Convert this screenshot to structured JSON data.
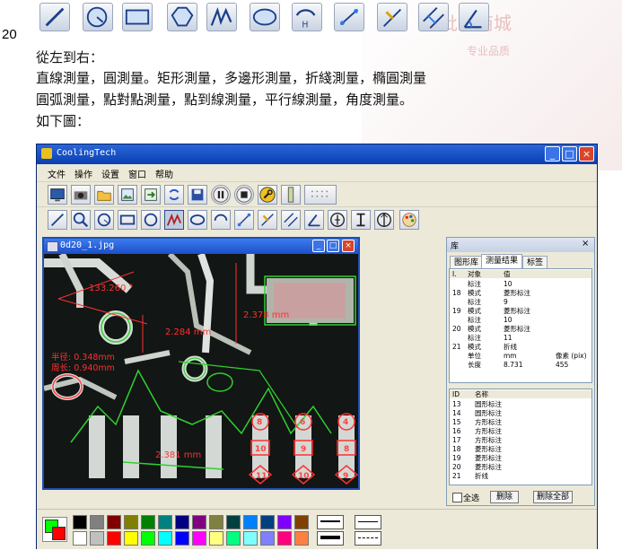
{
  "page_number": "20",
  "intro_line": "從左到右：",
  "line_1": "直線測量，圓測量。矩形測量，多邊形測量，折綫測量，橢圓測量",
  "line_2": "圓弧測量，點對點測量，點到線測量，平行線測量，角度測量。",
  "line_3": "如下圖：",
  "watermark": [
    "文批发商城",
    "专业品质"
  ],
  "top_tools": [
    "line-tool-icon",
    "circle-tool-icon",
    "rectangle-tool-icon",
    "polygon-tool-icon",
    "polyline-tool-icon",
    "ellipse-tool-icon",
    "arc-tool-icon",
    "point-to-point-icon",
    "point-to-line-icon",
    "parallel-lines-icon",
    "angle-tool-icon"
  ],
  "app": {
    "title": "CoolingTech",
    "menus": [
      "文件",
      "操作",
      "设置",
      "窗口",
      "帮助"
    ],
    "image_window_title": "0d20_1.jpg",
    "measurements": {
      "angle": "133.260 °",
      "distance1": "2.284 mm",
      "rect": "2.378 mm",
      "radius": "半径: 0.348mm",
      "perimeter": "周长: 0.940mm",
      "length": "2.381 mm"
    },
    "panel": {
      "title": "库",
      "tabs": [
        "图形库",
        "测量结果",
        "标签"
      ],
      "list1_header": [
        "I.",
        "对象",
        "值"
      ],
      "list1_rows": [
        [
          "",
          "标注",
          "10"
        ],
        [
          "18",
          "模式",
          "菱形标注"
        ],
        [
          "",
          "标注",
          "9"
        ],
        [
          "19",
          "模式",
          "菱形标注"
        ],
        [
          "",
          "标注",
          "10"
        ],
        [
          "20",
          "模式",
          "菱形标注"
        ],
        [
          "",
          "标注",
          "11"
        ],
        [
          "21",
          "模式",
          "折线"
        ],
        [
          "",
          "单位",
          "mm"
        ],
        [
          "",
          "长度",
          "8.731"
        ]
      ],
      "list1_extra": [
        "像素 (pix)",
        "455"
      ],
      "list2_header": [
        "ID",
        "名称"
      ],
      "list2_rows": [
        [
          "13",
          "圆形标注"
        ],
        [
          "14",
          "圆形标注"
        ],
        [
          "15",
          "方形标注"
        ],
        [
          "16",
          "方形标注"
        ],
        [
          "17",
          "方形标注"
        ],
        [
          "18",
          "菱形标注"
        ],
        [
          "19",
          "菱形标注"
        ],
        [
          "20",
          "菱形标注"
        ],
        [
          "21",
          "折线"
        ]
      ],
      "select_all": "全选",
      "delete_btn": "删除",
      "delete_all_btn": "删除全部"
    },
    "palette_colors_top": [
      "#000000",
      "#808080",
      "#800000",
      "#808000",
      "#008000",
      "#008080",
      "#000080",
      "#800080",
      "#808040",
      "#004040",
      "#0080ff",
      "#004080",
      "#8000ff",
      "#804000"
    ],
    "palette_colors_bottom": [
      "#ffffff",
      "#c0c0c0",
      "#ff0000",
      "#ffff00",
      "#00ff00",
      "#00ffff",
      "#0000ff",
      "#ff00ff",
      "#ffff80",
      "#00ff80",
      "#80ffff",
      "#8080ff",
      "#ff0080",
      "#ff8040"
    ]
  }
}
